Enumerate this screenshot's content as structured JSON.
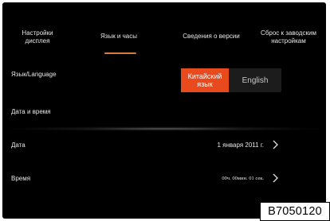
{
  "tabs": [
    {
      "label": "Настройки дисплея",
      "active": false
    },
    {
      "label": "Язык и часы",
      "active": true
    },
    {
      "label": "Сведения о версии",
      "active": false
    },
    {
      "label": "Сброс к заводским настройкам",
      "active": false
    }
  ],
  "language": {
    "label": "Язык/Language",
    "options": [
      "Китайский язык",
      "English"
    ],
    "selected": "Китайский язык"
  },
  "datetime_section": {
    "label": "Дата и время"
  },
  "date": {
    "label": "Дата",
    "value": "1 января 2011 г."
  },
  "time": {
    "label": "Время",
    "value": "00ч. 00мин. 01 сек."
  },
  "figure_code": "B7050120",
  "colors": {
    "background": "#000000",
    "accent_orange": "#e84a1e",
    "tab_indicator": "#d87a3c",
    "text": "#e8e8e8"
  },
  "icons": {
    "row_arrow": "chevron-right-icon"
  }
}
